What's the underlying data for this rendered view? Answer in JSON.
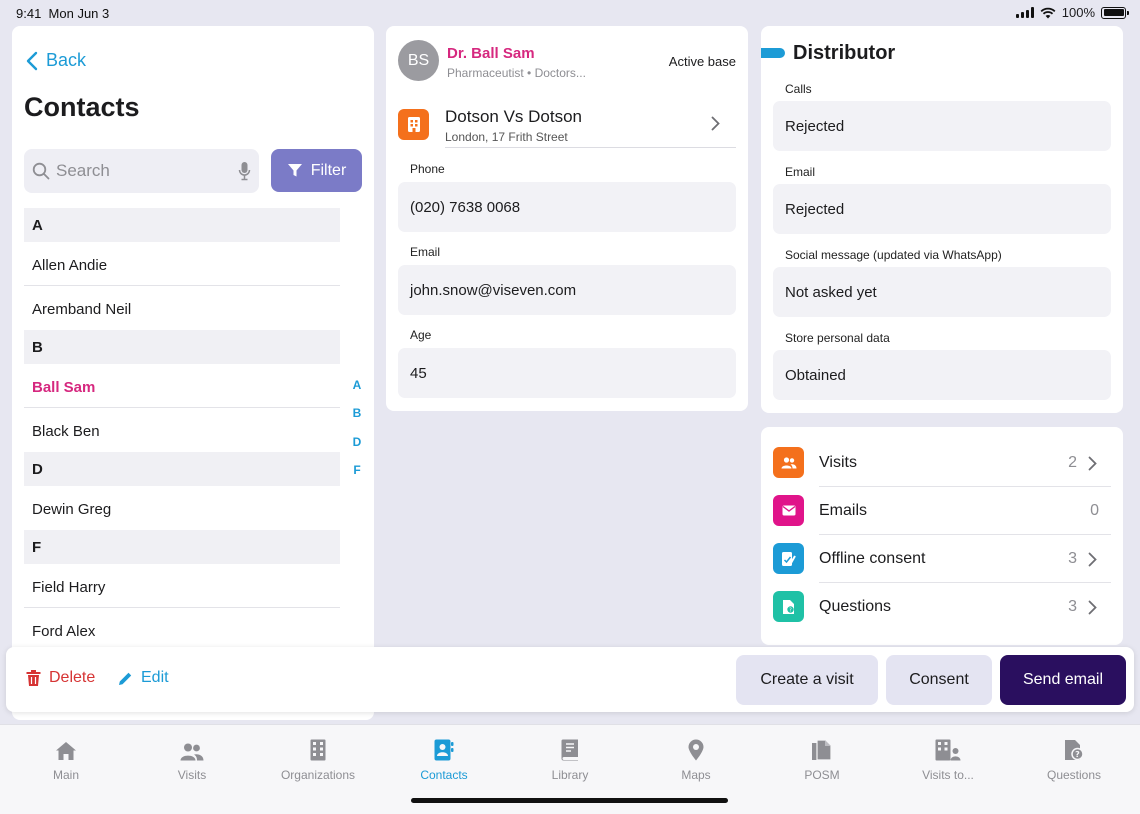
{
  "status_bar": {
    "time": "9:41",
    "date": "Mon Jun 3",
    "battery": "100%"
  },
  "left": {
    "back_label": "Back",
    "title": "Contacts",
    "search_placeholder": "Search",
    "filter_label": "Filter",
    "sections": [
      {
        "letter": "A",
        "contacts": [
          "Allen Andie",
          "Aremband Neil"
        ]
      },
      {
        "letter": "B",
        "contacts": [
          "Ball Sam",
          "Black Ben"
        ]
      },
      {
        "letter": "D",
        "contacts": [
          "Dewin Greg"
        ]
      },
      {
        "letter": "F",
        "contacts": [
          "Field Harry",
          "Ford Alex"
        ]
      }
    ],
    "selected_contact": "Ball Sam",
    "alpha_index": [
      "A",
      "B",
      "D",
      "F"
    ]
  },
  "profile": {
    "initials": "BS",
    "name": "Dr. Ball Sam",
    "subtitle": "Pharmaceutist • Doctors...",
    "status": "Active base",
    "organization": {
      "name": "Dotson Vs Dotson",
      "address": "London, 17 Frith Street"
    },
    "fields": [
      {
        "label": "Phone",
        "value": "(020) 7638 0068"
      },
      {
        "label": "Email",
        "value": "john.snow@viseven.com"
      },
      {
        "label": "Age",
        "value": "45"
      }
    ]
  },
  "distributor": {
    "title": "Distributor",
    "fields": [
      {
        "label": "Calls",
        "value": "Rejected"
      },
      {
        "label": "Email",
        "value": "Rejected"
      },
      {
        "label": "Social message (updated via WhatsApp)",
        "value": "Not asked yet"
      },
      {
        "label": "Store personal data",
        "value": "Obtained"
      }
    ]
  },
  "stats": [
    {
      "label": "Visits",
      "count": "2",
      "icon": "people-icon",
      "color": "#f4701c",
      "chevron": true
    },
    {
      "label": "Emails",
      "count": "0",
      "icon": "mail-icon",
      "color": "#e0148a",
      "chevron": false
    },
    {
      "label": "Offline consent",
      "count": "3",
      "icon": "consent-icon",
      "color": "#1c9bd6",
      "chevron": true
    },
    {
      "label": "Questions",
      "count": "3",
      "icon": "question-icon",
      "color": "#1fc1a6",
      "chevron": true
    }
  ],
  "actions": {
    "delete_label": "Delete",
    "edit_label": "Edit",
    "create_visit_label": "Create a visit",
    "consent_label": "Consent",
    "send_email_label": "Send email"
  },
  "tabs": [
    {
      "label": "Main",
      "icon": "home-icon"
    },
    {
      "label": "Visits",
      "icon": "people-icon"
    },
    {
      "label": "Organizations",
      "icon": "building-icon"
    },
    {
      "label": "Contacts",
      "icon": "contacts-icon",
      "active": true
    },
    {
      "label": "Library",
      "icon": "book-icon"
    },
    {
      "label": "Maps",
      "icon": "map-pin-icon"
    },
    {
      "label": "POSM",
      "icon": "documents-icon"
    },
    {
      "label": "Visits to...",
      "icon": "building-person-icon"
    },
    {
      "label": "Questions",
      "icon": "question-document-icon"
    }
  ],
  "colors": {
    "accent": "#1c9bd6",
    "selected": "#d6287f",
    "filter": "#7b7bc7",
    "primary_button": "#2a0f5f",
    "delete": "#d63434"
  }
}
